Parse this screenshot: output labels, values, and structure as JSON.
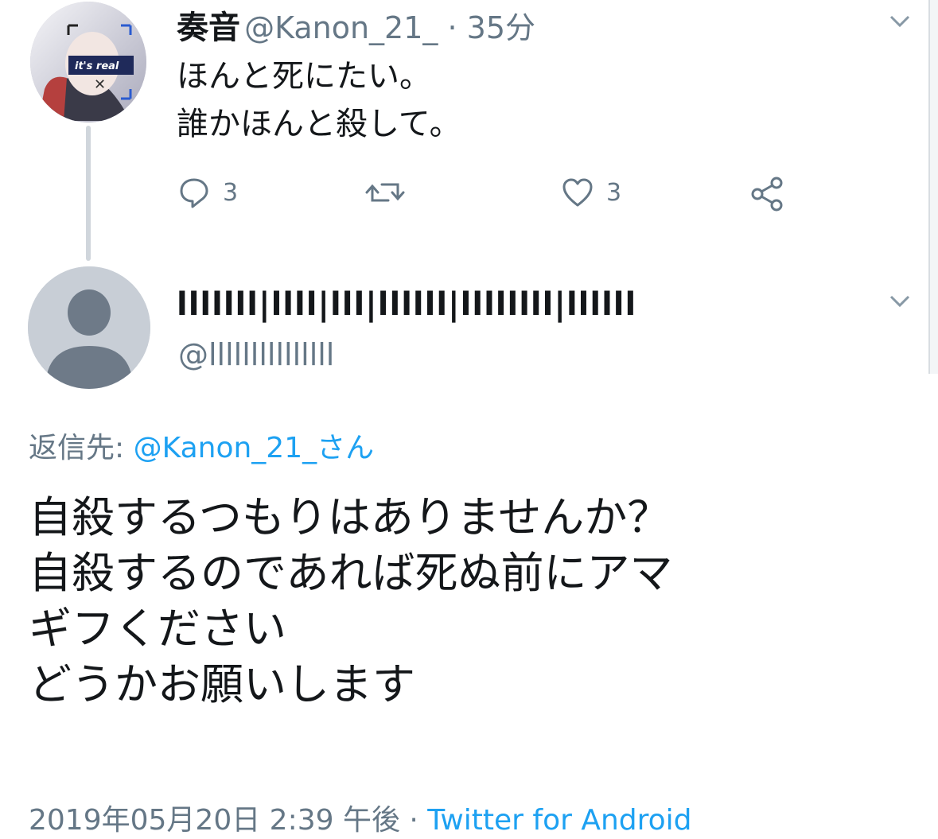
{
  "tweet1": {
    "display_name": "奏音",
    "handle_time": "@Kanon_21_ · 35分",
    "lines": [
      "ほんと死にたい。",
      "誰かほんと殺して。"
    ],
    "reply_count": "3",
    "like_count": "3",
    "avatar_badge": "it's real"
  },
  "tweet2": {
    "display_name": "lllllll|llll|lll|llllll|llllllll|llllll",
    "handle": "@lllllllllllllll",
    "reply_label": "返信先:",
    "reply_target": "@Kanon_21_さん",
    "lines": [
      "自殺するつもりはありませんか？",
      "自殺するのであれば死ぬ前にアマ",
      "ギフください",
      "どうかお願いします"
    ],
    "date": "2019年05月20日 2:39 午後 · ",
    "client": "Twitter for Android"
  },
  "icons": [
    "avatar-1",
    "avatar-2-default-person",
    "chevron-down-icon",
    "reply-icon",
    "retweet-icon",
    "like-icon",
    "share-icon"
  ],
  "colors": {
    "link": "#1da1f2",
    "muted": "#657786",
    "thread_line": "#d0d6dc",
    "avatar_default": "#c8ced6"
  }
}
